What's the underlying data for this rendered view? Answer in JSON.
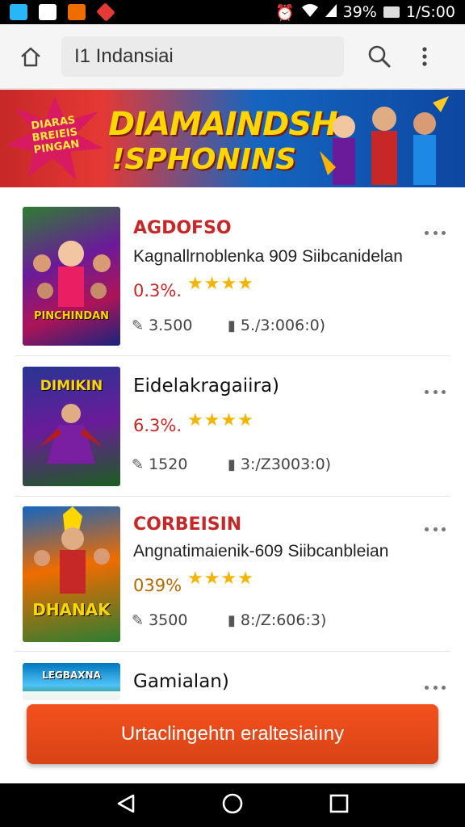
{
  "status_bar": {
    "battery": "39%",
    "time": "1/S:00"
  },
  "appbar": {
    "search_text": "I1 Indansiai"
  },
  "banner": {
    "burst_text": "DIARAS BREIEIS PINGAN",
    "line1": "DIAMAINDSH",
    "line2": "!SPHONINS"
  },
  "items": [
    {
      "title": "AGDOFSO",
      "subtitle": "Kagnallrnoblenka 909 Siibcanidelan",
      "rating": "0.3%.",
      "stars": "★★★★",
      "downloads": "3.500",
      "size": "5./3:006:0)",
      "thumb_label": "PINCHINDAN"
    },
    {
      "title": "Eidelakragaiira)",
      "rating": "6.3%.",
      "stars": "★★★★",
      "downloads": "1520",
      "size": "3:/Z3003:0)",
      "thumb_label": "DIMIKIN"
    },
    {
      "title": "CORBEISIN",
      "subtitle": "Angnatimaienik-609 Siibcanbleian",
      "rating": "039%",
      "stars": "★★★★",
      "downloads": "3500",
      "size": "8:/Z:606:3)",
      "thumb_label": "DHANAK"
    },
    {
      "title": "Gamialan)",
      "thumb_label": "LEGBAXNA"
    }
  ],
  "cta": {
    "label": "Urtaclingehtn eraltesiaiıny"
  },
  "colors": {
    "accent": "#c62828",
    "cta": "#e64a19",
    "star": "#f5b400"
  }
}
